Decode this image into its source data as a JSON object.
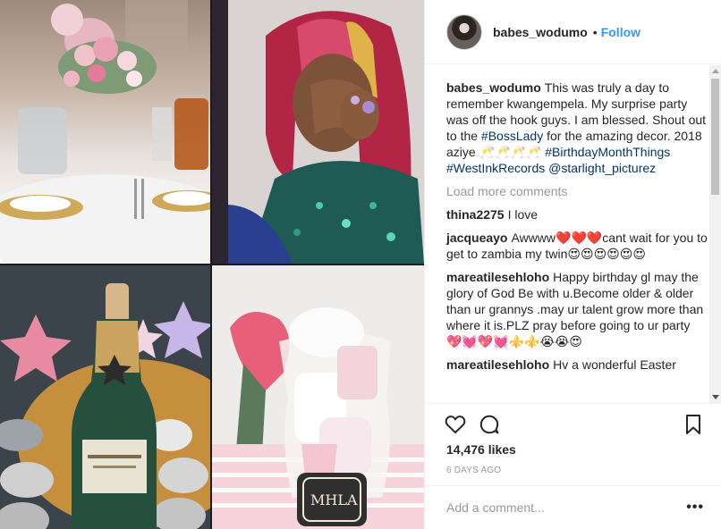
{
  "colors": {
    "link": "#3897f0",
    "hashtag": "#003569",
    "muted": "#999999",
    "text": "#262626"
  },
  "header": {
    "username": "babes_wodumo",
    "separator": "•",
    "follow_label": "Follow"
  },
  "caption": {
    "user": "babes_wodumo",
    "text_1": "This was truly a day to remember kwangempela. My surprise party was off the hook guys. I am blessed. Shout out to the ",
    "tag_1": "#BossLady",
    "text_2": " for the amazing decor. 2018 aziye 🥂🥂🥂🥂 ",
    "tag_2": "#BirthdayMonthThings",
    "text_3": " ",
    "tag_3": "#WestInkRecords",
    "text_4": " ",
    "tag_4": "@starlight_picturez"
  },
  "load_more": "Load more comments",
  "comments": [
    {
      "user": "thina2275",
      "text": "I love"
    },
    {
      "user": "jacqueayo",
      "text": "Awwww❤️❤️❤️cant wait for you to get to zambia my twin😍😍😍😍😍😍"
    },
    {
      "user": "mareatilesehloho",
      "text": "Happy birthday gl may the glory of God Be with u.Become older & older than ur grannys .may ur talent grow more than where it is.PLZ pray before going to ur party 💖💓💖💓⚜️⚜️😭😭😍"
    },
    {
      "user": "mareatilesehloho",
      "text": "Hv a wonderful Easter"
    }
  ],
  "actions": {
    "like_icon": "heart-icon",
    "comment_icon": "comment-bubble-icon",
    "save_icon": "bookmark-icon"
  },
  "likes": "14,476 likes",
  "timestamp": "6 DAYS AGO",
  "add_comment": {
    "placeholder": "Add a comment...",
    "more_label": "•••"
  }
}
